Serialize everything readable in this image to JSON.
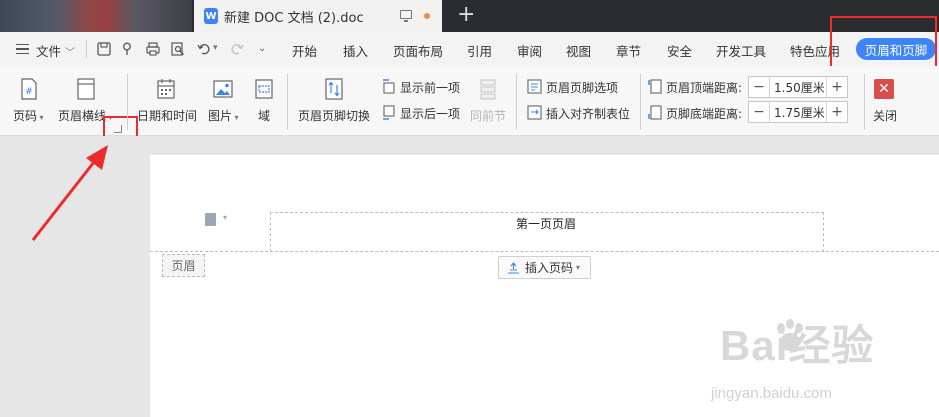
{
  "tab": {
    "title": "新建 DOC 文档 (2).doc",
    "app_icon_letter": "W"
  },
  "menu": {
    "file": "文件",
    "items": [
      "开始",
      "插入",
      "页面布局",
      "引用",
      "审阅",
      "视图",
      "章节",
      "安全",
      "开发工具",
      "特色应用"
    ],
    "active": "页眉和页脚"
  },
  "ribbon": {
    "page_number": "页码",
    "header_line": "页眉横线",
    "date_time": "日期和时间",
    "picture": "图片",
    "field": "域",
    "switch": "页眉页脚切换",
    "show_prev": "显示前一项",
    "show_next": "显示后一项",
    "same_as_prev": "同前节",
    "options": "页眉页脚选项",
    "insert_align_tab": "插入对齐制表位",
    "header_top_label": "页眉顶端距离:",
    "header_top_value": "1.50厘米",
    "footer_bottom_label": "页脚底端距离:",
    "footer_bottom_value": "1.75厘米",
    "close": "关闭"
  },
  "document": {
    "header_text": "第一页页眉",
    "header_label": "页眉",
    "insert_page_number": "插入页码"
  },
  "watermark": {
    "main": "Bai经验",
    "sub": "jingyan.baidu.com"
  },
  "colors": {
    "accent": "#3e84f6",
    "highlight_red": "#ec2b2b",
    "close_red": "#d94c4c"
  }
}
